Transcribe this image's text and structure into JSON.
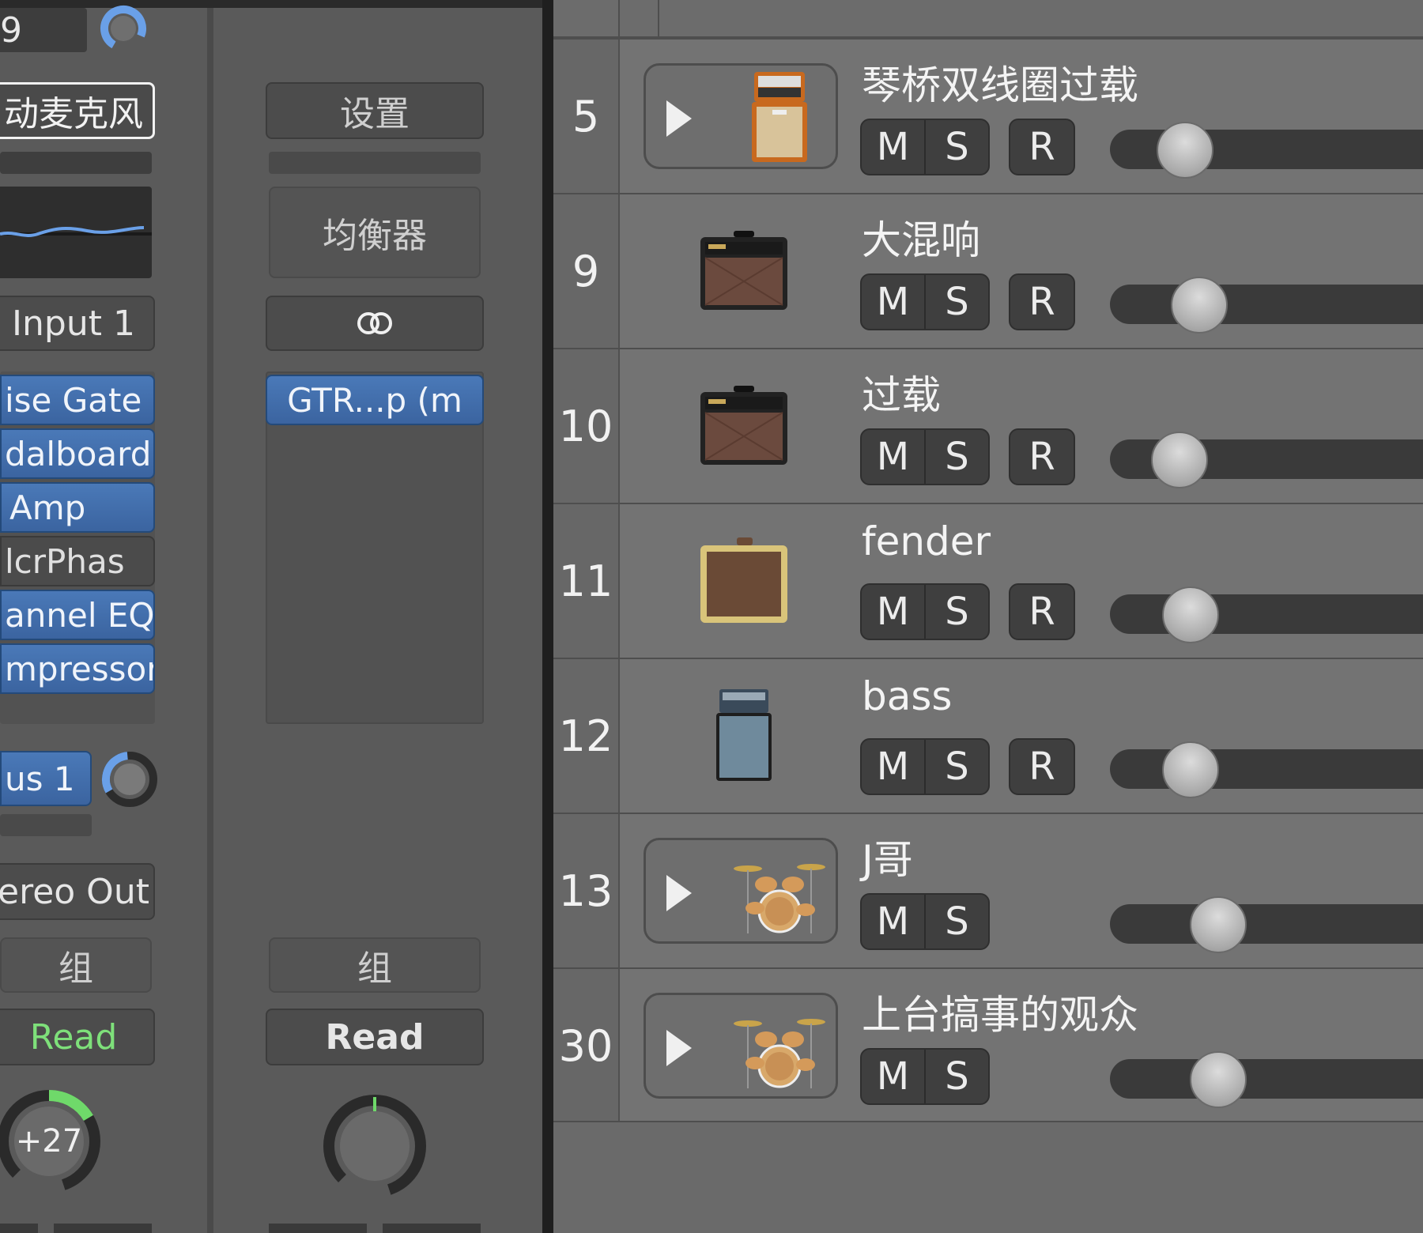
{
  "mixer": {
    "strip1": {
      "number": "9",
      "input_device": "动麦克风",
      "input": "Input 1",
      "plugins": [
        "ise Gate",
        "dalboard",
        "Amp",
        "lcrPhas",
        "annel EQ",
        "mpressor"
      ],
      "send": "us 1",
      "output": "ereo Out",
      "group": "组",
      "automation": "Read",
      "gain": "+27"
    },
    "strip2": {
      "settings": "设置",
      "eq": "均衡器",
      "link_symbol": "⚭",
      "plugin": "GTR...p (m",
      "group": "组",
      "automation": "Read"
    }
  },
  "tracks": [
    {
      "number": "5",
      "name": "琴桥双线圈过载",
      "icon": "stack-amp-icon",
      "has_record": true,
      "folder": true,
      "volume": 0.17
    },
    {
      "number": "9",
      "name": "大混响",
      "icon": "combo-amp-black-icon",
      "has_record": true,
      "folder": false,
      "volume": 0.22
    },
    {
      "number": "10",
      "name": "过载",
      "icon": "combo-amp-black-icon",
      "has_record": true,
      "folder": false,
      "volume": 0.15
    },
    {
      "number": "11",
      "name": "fender",
      "icon": "tweed-amp-icon",
      "has_record": true,
      "folder": false,
      "volume": 0.19
    },
    {
      "number": "12",
      "name": "bass",
      "icon": "bass-amp-icon",
      "has_record": true,
      "folder": false,
      "volume": 0.19
    },
    {
      "number": "13",
      "name": "J哥",
      "icon": "drum-kit-icon",
      "has_record": false,
      "folder": true,
      "volume": 0.29
    },
    {
      "number": "30",
      "name": "上台搞事的观众",
      "icon": "drum-kit-icon",
      "has_record": false,
      "folder": true,
      "volume": 0.29
    }
  ],
  "labels": {
    "mute": "M",
    "solo": "S",
    "record": "R"
  },
  "colors": {
    "plugin_blue": "#4a79b8",
    "read_green": "#7ee07a",
    "send_knob_blue": "#6aa0e8",
    "gain_arc_green": "#6fd96a"
  }
}
